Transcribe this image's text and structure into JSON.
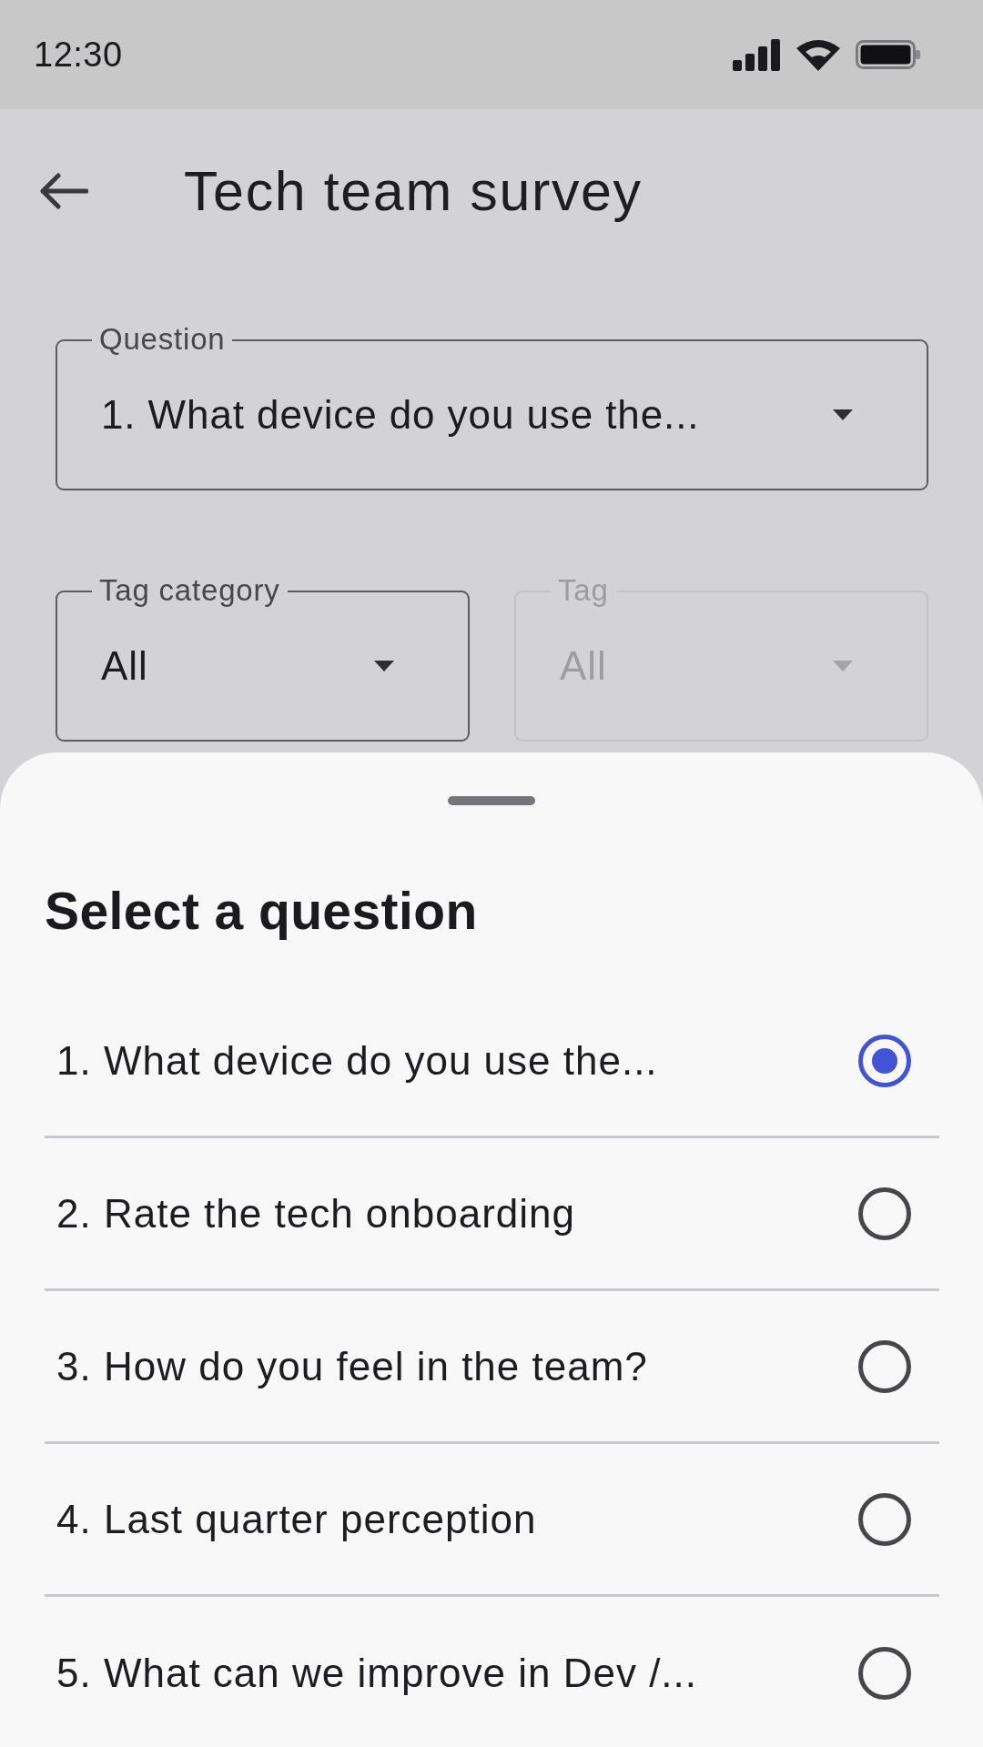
{
  "status_bar": {
    "time": "12:30"
  },
  "app_bar": {
    "title": "Tech team survey"
  },
  "question_field": {
    "label": "Question",
    "value": "1. What device do you use the...",
    "disabled": false
  },
  "tag_fields": [
    {
      "label": "Tag category",
      "value": "All",
      "disabled": false
    },
    {
      "label": "Tag",
      "value": "All",
      "disabled": true
    }
  ],
  "sheet": {
    "title": "Select a question",
    "options": [
      {
        "label": "1. What device do you use the...",
        "selected": true
      },
      {
        "label": "2. Rate the tech onboarding",
        "selected": false
      },
      {
        "label": "3. How do you feel in the team?",
        "selected": false
      },
      {
        "label": "4. Last quarter perception",
        "selected": false
      },
      {
        "label": "5. What can we improve in Dev /...",
        "selected": false
      }
    ]
  }
}
